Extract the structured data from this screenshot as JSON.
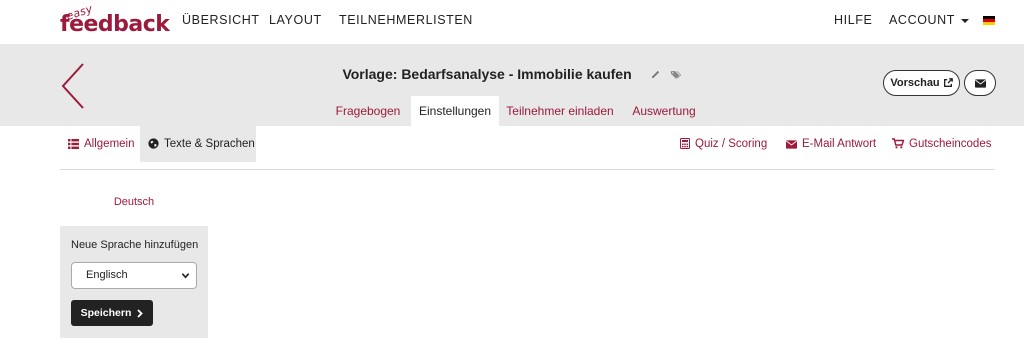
{
  "brand": {
    "top": "easy",
    "main": "feedback"
  },
  "nav": {
    "items": [
      "ÜBERSICHT",
      "LAYOUT",
      "TEILNEHMERLISTEN"
    ],
    "help": "HILFE",
    "account": "ACCOUNT"
  },
  "survey": {
    "title": "Vorlage: Bedarfsanalyse - Immobilie kaufen",
    "preview_label": "Vorschau"
  },
  "tabs": [
    "Fragebogen",
    "Einstellungen",
    "Teilnehmer einladen",
    "Auswertung"
  ],
  "subnav": {
    "general": "Allgemein",
    "texts": "Texte & Sprachen",
    "quiz": "Quiz / Scoring",
    "email": "E-Mail Antwort",
    "vouchers": "Gutscheincodes"
  },
  "language": {
    "current": "Deutsch",
    "add_label": "Neue Sprache hinzufügen",
    "selected": "Englisch",
    "save_label": "Speichern"
  },
  "colors": {
    "accent": "#9c1a3c",
    "header_bg": "#e8e8e8",
    "dark": "#222222"
  }
}
